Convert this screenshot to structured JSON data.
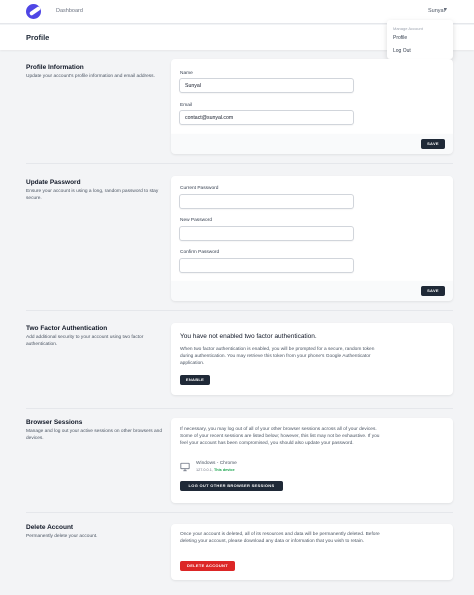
{
  "nav": {
    "dashboard": "Dashboard",
    "user": "Sunyal",
    "dropdown": {
      "header": "Manage Account",
      "profile": "Profile",
      "logout": "Log Out"
    }
  },
  "page": {
    "title": "Profile"
  },
  "profile_info": {
    "title": "Profile Information",
    "description": "Update your account's profile information and email address.",
    "name_label": "Name",
    "name_value": "Sunyal",
    "email_label": "Email",
    "email_value": "contact@sunyal.com",
    "save": "SAVE"
  },
  "password": {
    "title": "Update Password",
    "description": "Ensure your account is using a long, random password to stay secure.",
    "current_label": "Current Password",
    "new_label": "New Password",
    "confirm_label": "Confirm Password",
    "save": "SAVE"
  },
  "two_factor": {
    "title": "Two Factor Authentication",
    "description": "Add additional security to your account using two factor authentication.",
    "status_heading": "You have not enabled two factor authentication.",
    "body": "When two factor authentication is enabled, you will be prompted for a secure, random token during authentication. You may retrieve this token from your phone's Google Authenticator application.",
    "enable": "ENABLE"
  },
  "sessions": {
    "title": "Browser Sessions",
    "description": "Manage and log out your active sessions on other browsers and devices.",
    "body": "If necessary, you may log out of all of your other browser sessions across all of your devices. Some of your recent sessions are listed below; however, this list may not be exhaustive. If you feel your account has been compromised, you should also update your password.",
    "device": "Windows - Chrome",
    "ip": "127.0.0.1,",
    "this_device": "This device",
    "logout_button": "LOG OUT OTHER BROWSER SESSIONS"
  },
  "delete": {
    "title": "Delete Account",
    "description": "Permanently delete your account.",
    "body": "Once your account is deleted, all of its resources and data will be permanently deleted. Before deleting your account, please download any data or information that you wish to retain.",
    "button": "DELETE ACCOUNT"
  },
  "colors": {
    "accent": "#4f46e5",
    "dark_button": "#1f2937",
    "danger": "#dc2626",
    "background": "#f3f4f6"
  },
  "icons": {
    "logo": "app-logo",
    "chevron": "chevron-down-icon",
    "device": "monitor-icon"
  }
}
